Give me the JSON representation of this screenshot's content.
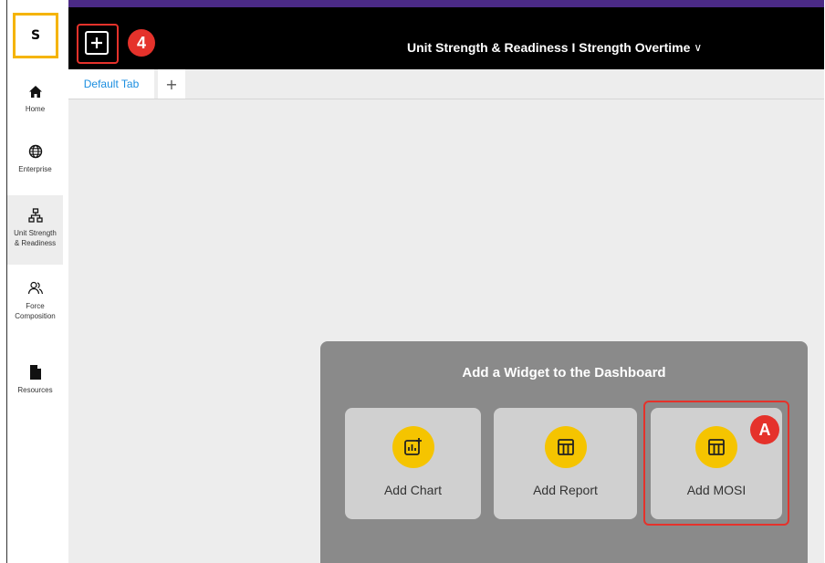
{
  "app": {
    "logo_letter": "S",
    "title": "Unit Strength & Readiness I Strength Overtime",
    "title_chevron": "∨"
  },
  "header": {
    "add_button_icon": "plus-icon",
    "callout_number": "4"
  },
  "sidebar": {
    "items": [
      {
        "label_lines": [
          "Home"
        ],
        "icon": "home-icon"
      },
      {
        "label_lines": [
          "Enterprise"
        ],
        "icon": "globe-icon"
      },
      {
        "label_lines": [
          "Unit Strength",
          "& Readiness"
        ],
        "icon": "org-chart-icon",
        "active": true
      },
      {
        "label_lines": [
          "Force",
          "Composition"
        ],
        "icon": "people-icon"
      },
      {
        "label_lines": [
          "Resources"
        ],
        "icon": "document-icon"
      }
    ]
  },
  "tabs": {
    "items": [
      {
        "label": "Default Tab",
        "active": true
      }
    ],
    "add_label": "+"
  },
  "widget_panel": {
    "title": "Add a Widget to the Dashboard",
    "cards": [
      {
        "label": "Add Chart",
        "icon": "chart-add-icon"
      },
      {
        "label": "Add Report",
        "icon": "report-icon"
      },
      {
        "label": "Add MOSI",
        "icon": "table-icon"
      }
    ],
    "callout_letter": "A"
  },
  "colors": {
    "accent_yellow": "#f5c400",
    "logo_border": "#f5b400",
    "header_bg": "#000000",
    "top_strip": "#4b2a86",
    "highlight_red": "#e5322b",
    "tab_text": "#1b8ee0",
    "panel_bg": "#8a8a8a",
    "card_bg": "#d0d0d0"
  }
}
